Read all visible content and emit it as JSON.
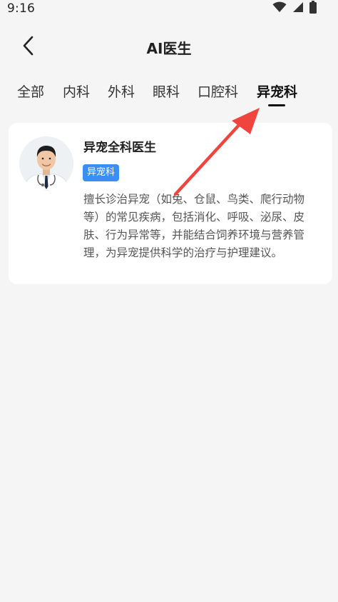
{
  "status_bar": {
    "time": "9:16",
    "icons": [
      "wifi-icon",
      "signal-icon",
      "battery-icon"
    ]
  },
  "header": {
    "back_icon": "chevron-left-icon",
    "title": "AI医生"
  },
  "tabs": [
    {
      "label": "全部",
      "active": false
    },
    {
      "label": "内科",
      "active": false
    },
    {
      "label": "外科",
      "active": false
    },
    {
      "label": "眼科",
      "active": false
    },
    {
      "label": "口腔科",
      "active": false
    },
    {
      "label": "异宠科",
      "active": true
    }
  ],
  "doctor_card": {
    "name": "异宠全科医生",
    "badge": "异宠科",
    "description": "擅长诊治异宠（如兔、仓鼠、鸟类、爬行动物等）的常见疾病，包括消化、呼吸、泌尿、皮肤、行为异常等，并能结合饲养环境与营养管理，为异宠提供科学的治疗与护理建议。"
  },
  "colors": {
    "accent": "#3a8ef6",
    "annotation": "#f0453f",
    "background": "#f5f5f5"
  }
}
